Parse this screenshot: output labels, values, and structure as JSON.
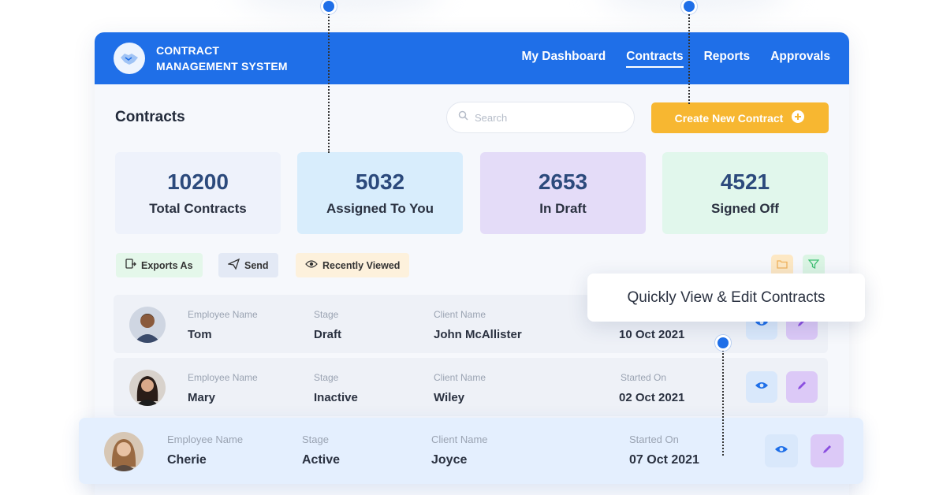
{
  "brand": {
    "line1": "CONTRACT",
    "line2": "MANAGEMENT SYSTEM",
    "logo_icon": "handshake-icon"
  },
  "nav": [
    {
      "label": "My Dashboard"
    },
    {
      "label": "Contracts",
      "active": true
    },
    {
      "label": "Reports"
    },
    {
      "label": "Approvals"
    }
  ],
  "page": {
    "title": "Contracts"
  },
  "search": {
    "placeholder": "Search"
  },
  "create_button": {
    "label": "Create New Contract",
    "icon": "plus-circle-icon"
  },
  "stats": [
    {
      "value": "10200",
      "label": "Total Contracts",
      "color": "#eef2fb"
    },
    {
      "value": "5032",
      "label": "Assigned To You",
      "color": "#d8edfc"
    },
    {
      "value": "2653",
      "label": "In Draft",
      "color": "#e4dcf8"
    },
    {
      "value": "4521",
      "label": "Signed Off",
      "color": "#e1f7ec"
    }
  ],
  "toolbar": {
    "export_label": "Exports As",
    "send_label": "Send",
    "recent_label": "Recently Viewed"
  },
  "columns": {
    "employee": "Employee Name",
    "stage": "Stage",
    "client": "Client Name",
    "started": "Started On"
  },
  "rows": [
    {
      "employee": "Tom",
      "stage": "Draft",
      "client": "John McAllister",
      "started": "10 Oct 2021"
    },
    {
      "employee": "Mary",
      "stage": "Inactive",
      "client": "Wiley",
      "started": "02 Oct 2021"
    },
    {
      "employee": "Cherie",
      "stage": "Active",
      "client": "Joyce",
      "started": "07 Oct 2021"
    }
  ],
  "tooltip": {
    "text": "Quickly View & Edit Contracts"
  },
  "colors": {
    "primary": "#1f6fe8",
    "accent": "#f7b731"
  }
}
